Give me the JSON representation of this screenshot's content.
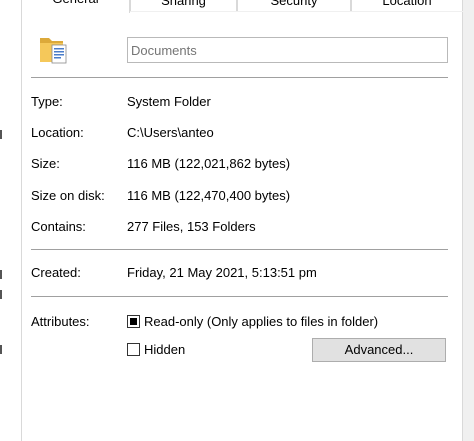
{
  "tabs": [
    {
      "label": "General",
      "active": true
    },
    {
      "label": "Sharing",
      "active": false
    },
    {
      "label": "Security",
      "active": false
    },
    {
      "label": "Location",
      "active": false
    }
  ],
  "folder": {
    "icon": "folder-document-icon",
    "name_placeholder": "Documents",
    "name_value": ""
  },
  "properties": {
    "type_label": "Type:",
    "type_value": "System Folder",
    "location_label": "Location:",
    "location_value": "C:\\Users\\anteo",
    "size_label": "Size:",
    "size_value": "116 MB (122,021,862 bytes)",
    "disk_label": "Size on disk:",
    "disk_value": "116 MB (122,470,400 bytes)",
    "contains_label": "Contains:",
    "contains_value": "277 Files, 153 Folders",
    "created_label": "Created:",
    "created_value": "Friday, 21 May 2021, 5:13:51 pm"
  },
  "attributes": {
    "label": "Attributes:",
    "readonly_label": "Read-only (Only applies to files in folder)",
    "readonly_state": "indeterminate",
    "hidden_label": "Hidden",
    "hidden_state": "unchecked",
    "advanced_label": "Advanced..."
  },
  "colors": {
    "folder_yellow": "#f5c85a",
    "folder_dark": "#dca93a",
    "doc_blue": "#4a7cc9"
  }
}
